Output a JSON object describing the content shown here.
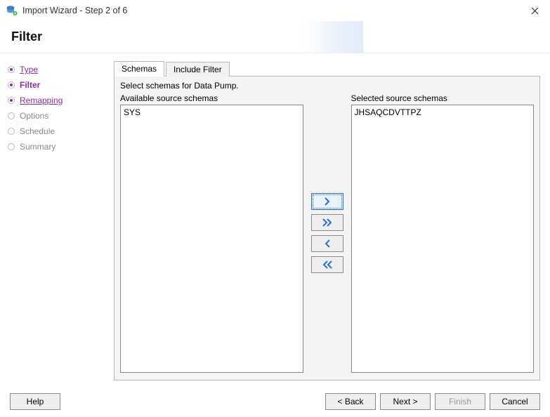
{
  "window": {
    "title": "Import Wizard - Step 2 of 6"
  },
  "page": {
    "title": "Filter"
  },
  "nav": {
    "items": [
      {
        "label": "Type",
        "state": "visited"
      },
      {
        "label": "Filter",
        "state": "current"
      },
      {
        "label": "Remapping",
        "state": "next"
      },
      {
        "label": "Options",
        "state": "future"
      },
      {
        "label": "Schedule",
        "state": "future"
      },
      {
        "label": "Summary",
        "state": "future"
      }
    ]
  },
  "tabs": {
    "items": [
      {
        "label": "Schemas",
        "active": true
      },
      {
        "label": "Include Filter",
        "active": false
      }
    ]
  },
  "content": {
    "instruction": "Select schemas for Data Pump.",
    "available_label": "Available source schemas",
    "selected_label": "Selected source schemas",
    "available_items": [
      "SYS"
    ],
    "selected_items": [
      "JHSAQCDVTTPZ"
    ]
  },
  "footer": {
    "help": "Help",
    "back": "< Back",
    "next": "Next >",
    "finish": "Finish",
    "cancel": "Cancel"
  }
}
